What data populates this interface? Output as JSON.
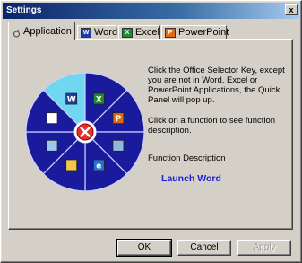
{
  "window": {
    "title": "Settings",
    "close_glyph": "x"
  },
  "tabs": [
    {
      "label": "Application",
      "icon": "sun-icon",
      "active": true
    },
    {
      "label": "Word",
      "icon": "word-icon",
      "color": "#1f3fa8"
    },
    {
      "label": "Excel",
      "icon": "excel-icon",
      "color": "#1e8c2e"
    },
    {
      "label": "PowerPoint",
      "icon": "powerpoint-icon",
      "color": "#e06a10"
    }
  ],
  "wheel": {
    "colors": {
      "segment": "#1a1a9c",
      "selected": "#6fd8f0",
      "center": "#e03030",
      "hub": "#ffffff"
    },
    "segments": [
      {
        "name": "word-launcher",
        "icon": "word-icon",
        "selected": true
      },
      {
        "name": "excel-launcher",
        "icon": "excel-icon"
      },
      {
        "name": "powerpoint-launcher",
        "icon": "powerpoint-icon"
      },
      {
        "name": "outlook-launcher",
        "icon": "monitor-icon"
      },
      {
        "name": "internet-explorer-launcher",
        "icon": "ie-icon"
      },
      {
        "name": "explorer-launcher",
        "icon": "folder-icon"
      },
      {
        "name": "network-launcher",
        "icon": "network-icon"
      },
      {
        "name": "file-launcher",
        "icon": "document-icon"
      }
    ]
  },
  "info": {
    "paragraph1": "Click the Office Selector Key, except you are not in Word, Excel or PowerPoint Applications, the Quick Panel will pop up.",
    "paragraph2": "Click on a function to see function description.",
    "description_label": "Function Description",
    "description_value": "Launch Word"
  },
  "buttons": {
    "ok": "OK",
    "cancel": "Cancel",
    "apply": "Apply"
  }
}
